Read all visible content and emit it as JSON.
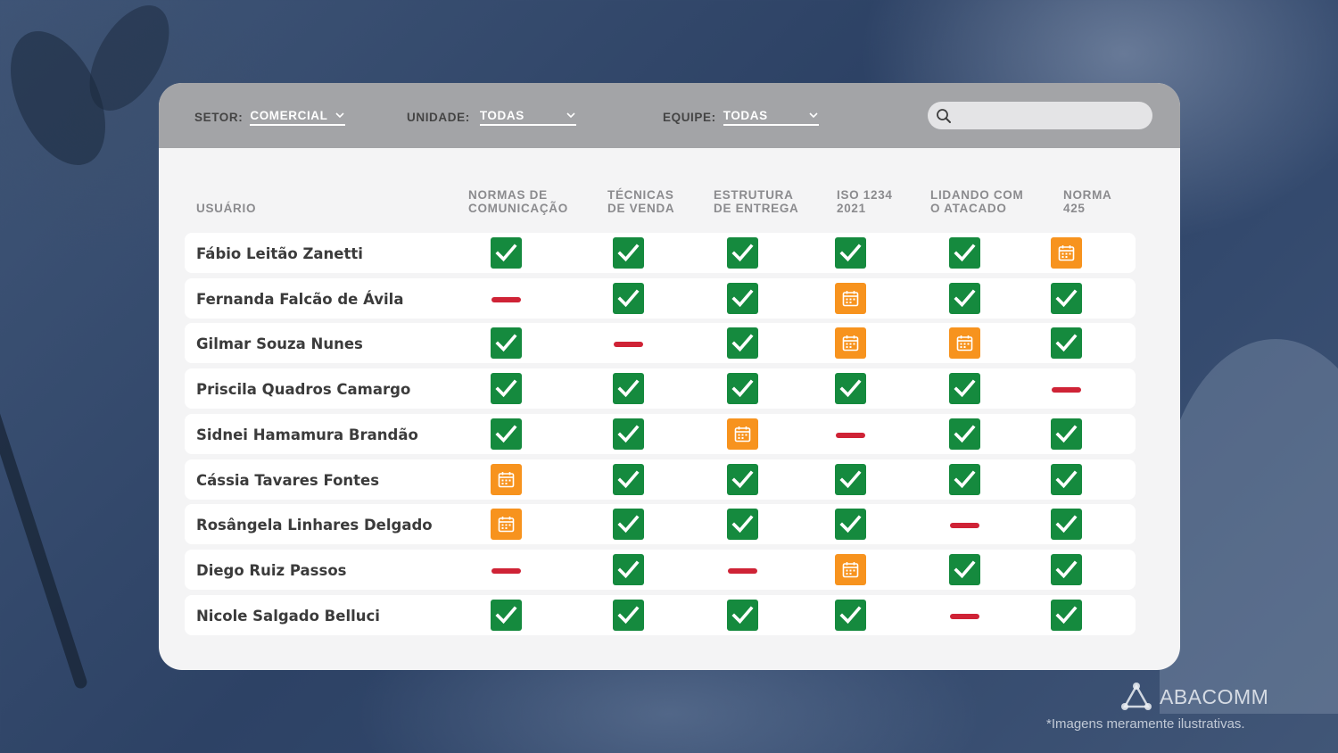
{
  "filters": {
    "setor": {
      "label": "SETOR:",
      "value": "COMERCIAL"
    },
    "unidade": {
      "label": "UNIDADE:",
      "value": "TODAS"
    },
    "equipe": {
      "label": "EQUIPE:",
      "value": "TODAS"
    }
  },
  "search": {
    "placeholder": ""
  },
  "columns": {
    "user": "USUÁRIO",
    "c1": [
      "NORMAS DE",
      "COMUNICAÇÃO"
    ],
    "c2": [
      "TÉCNICAS",
      "DE VENDA"
    ],
    "c3": [
      "ESTRUTURA",
      "DE ENTREGA"
    ],
    "c4": [
      "ISO 1234",
      "2021"
    ],
    "c5": [
      "LIDANDO COM",
      "O ATACADO"
    ],
    "c6": [
      "NORMA",
      "425"
    ]
  },
  "status_legend": {
    "done": "checkmark-icon",
    "pending": "calendar-icon",
    "missing": "red-dash"
  },
  "colors": {
    "done": "#158a3e",
    "pending": "#f7931e",
    "missing": "#cf2336"
  },
  "rows": [
    {
      "name": "Fábio Leitão Zanetti",
      "status": [
        "done",
        "done",
        "done",
        "done",
        "done",
        "pending"
      ]
    },
    {
      "name": "Fernanda Falcão de Ávila",
      "status": [
        "missing",
        "done",
        "done",
        "pending",
        "done",
        "done"
      ]
    },
    {
      "name": "Gilmar Souza Nunes",
      "status": [
        "done",
        "missing",
        "done",
        "pending",
        "pending",
        "done"
      ]
    },
    {
      "name": "Priscila Quadros Camargo",
      "status": [
        "done",
        "done",
        "done",
        "done",
        "done",
        "missing"
      ]
    },
    {
      "name": "Sidnei Hamamura Brandão",
      "status": [
        "done",
        "done",
        "pending",
        "missing",
        "done",
        "done"
      ]
    },
    {
      "name": "Cássia Tavares Fontes",
      "status": [
        "pending",
        "done",
        "done",
        "done",
        "done",
        "done"
      ]
    },
    {
      "name": "Rosângela Linhares Delgado",
      "status": [
        "pending",
        "done",
        "done",
        "done",
        "missing",
        "done"
      ]
    },
    {
      "name": "Diego Ruiz Passos",
      "status": [
        "missing",
        "done",
        "missing",
        "pending",
        "done",
        "done"
      ]
    },
    {
      "name": "Nicole Salgado Belluci",
      "status": [
        "done",
        "done",
        "done",
        "done",
        "missing",
        "done"
      ]
    }
  ],
  "brand": {
    "name": "ABACOMM",
    "disclaimer": "*Imagens meramente ilustrativas."
  }
}
